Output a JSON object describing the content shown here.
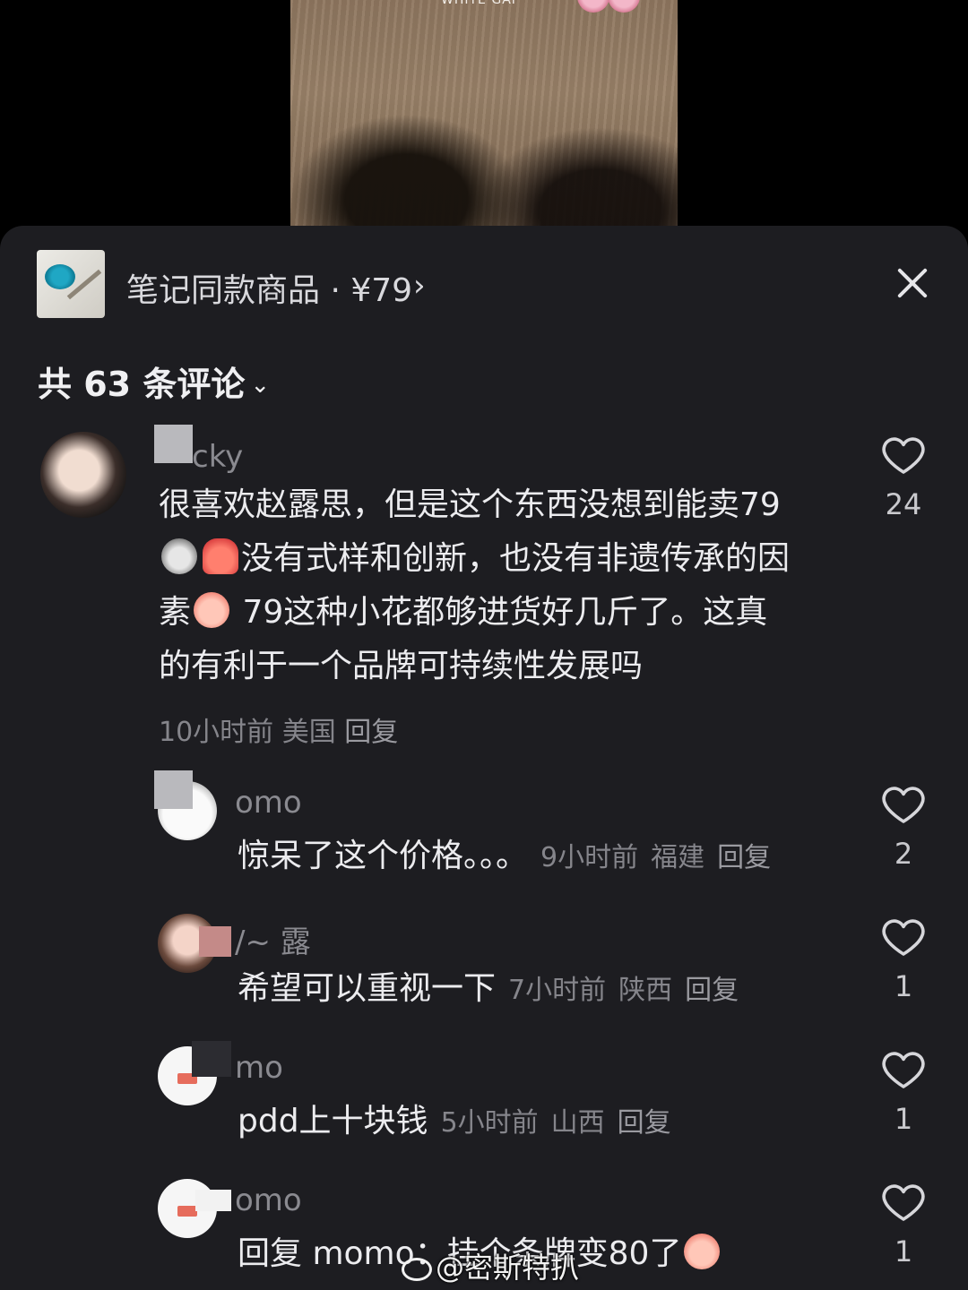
{
  "video": {
    "thumb_text": "WHITE GAP"
  },
  "product_bar": {
    "title": "笔记同款商品 · ¥79",
    "chevron": "›",
    "close_icon": "close-icon"
  },
  "comments_header": {
    "label": "共 63 条评论",
    "chevron": "⌄"
  },
  "comments": [
    {
      "username": "  cky",
      "text_parts": [
        "很喜欢赵露思，但是这个东西没想到能卖79",
        "没有式样和创新，也没有非遗传承的因",
        "素",
        " 79这种小花都够进货好几斤了。这真",
        "的有利于一个品牌可持续性发展吗"
      ],
      "time": "10小时前",
      "location": "美国",
      "reply": "回复",
      "likes": "24"
    }
  ],
  "replies": [
    {
      "username": "  omo",
      "text": "惊呆了这个价格。。。",
      "time": "9小时前",
      "location": "福建",
      "reply": "回复",
      "likes": "2"
    },
    {
      "username": "  /~ 露",
      "text": "希望可以重视一下",
      "time": "7小时前",
      "location": "陕西",
      "reply": "回复",
      "likes": "1"
    },
    {
      "username": "  mo",
      "text": "pdd上十块钱",
      "time": "5小时前",
      "location": "山西",
      "reply": "回复",
      "likes": "1"
    },
    {
      "username": "  omo",
      "text": "回复 momo：挂个条牌变80了",
      "likes": "1"
    }
  ],
  "watermark": "@密斯特扒",
  "colors": {
    "sheet_bg": "#1d1d21",
    "text": "#ececef",
    "meta": "#85858b"
  }
}
